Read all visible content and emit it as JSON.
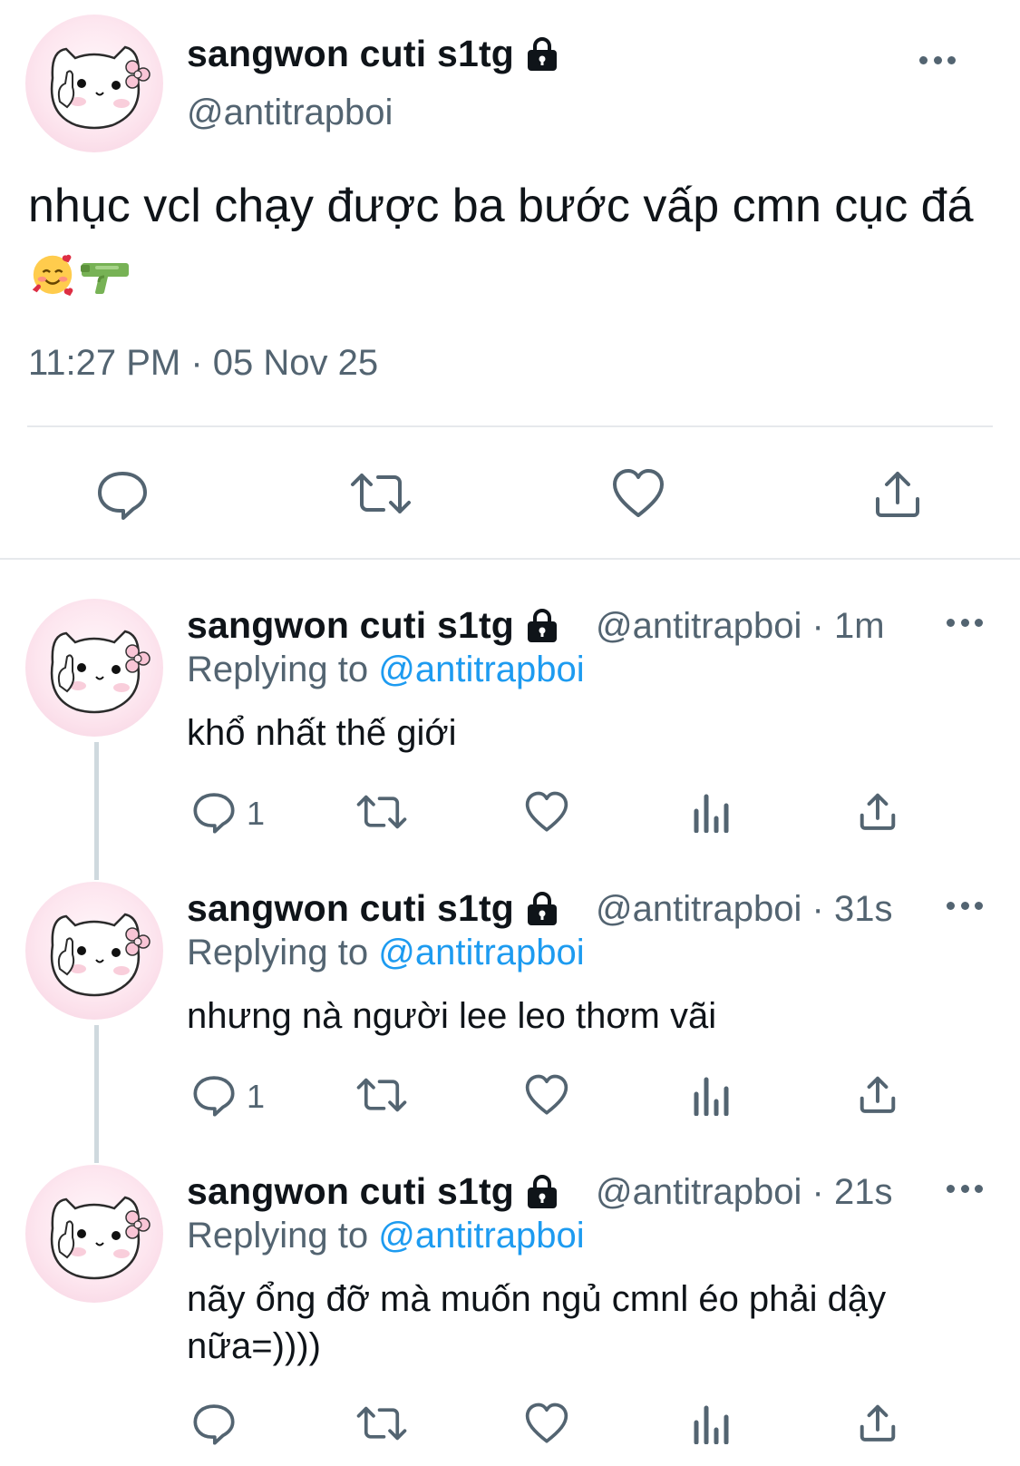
{
  "main_tweet": {
    "display_name": "sangwon cuti s1tg",
    "handle": "@antitrapboi",
    "text": "nhục vcl chạy được ba bước vấp cmn cục đá",
    "emojis": [
      "smiling-face-with-hearts",
      "water-pistol"
    ],
    "timestamp": "11:27 PM · 05 Nov 25"
  },
  "replies": [
    {
      "display_name": "sangwon cuti s1tg",
      "meta": "@antitrapboi · 1m",
      "replying_label": "Replying to ",
      "replying_handle": "@antitrapboi",
      "text": "khổ nhất thế giới",
      "reply_count": "1"
    },
    {
      "display_name": "sangwon cuti s1tg",
      "meta": "@antitrapboi · 31s",
      "replying_label": "Replying to ",
      "replying_handle": "@antitrapboi",
      "text": "nhưng nà người lee leo thơm vãi",
      "reply_count": "1"
    },
    {
      "display_name": "sangwon cuti s1tg",
      "meta": "@antitrapboi · 21s",
      "replying_label": "Replying to ",
      "replying_handle": "@antitrapboi",
      "text": "nãy ổng đỡ mà muốn ngủ cmnl éo phải dậy nữa=))))",
      "reply_count": ""
    }
  ],
  "icons": {
    "lock": "lock-icon",
    "more": "more-icon",
    "reply": "reply-icon",
    "retweet": "retweet-icon",
    "like": "like-icon",
    "views": "views-icon",
    "share": "share-icon"
  },
  "colors": {
    "text": "#0f1419",
    "secondary": "#536471",
    "link": "#1d9bf0",
    "divider": "#e6e9ec"
  }
}
